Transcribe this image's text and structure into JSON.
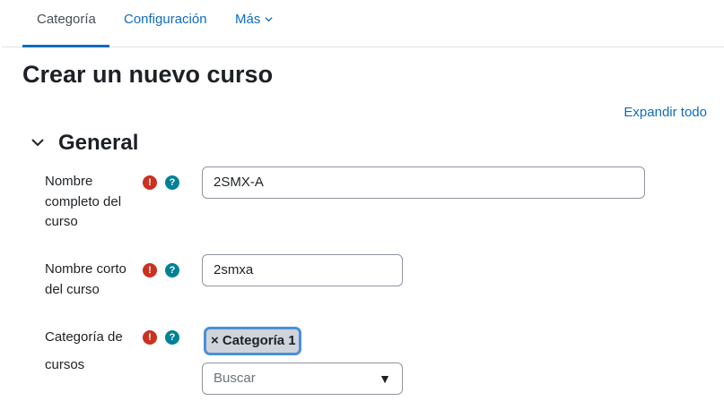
{
  "tabs": [
    {
      "label": "Categoría",
      "active": true
    },
    {
      "label": "Configuración"
    },
    {
      "label": "Más"
    }
  ],
  "page_title": "Crear un nuevo curso",
  "expand_all": "Expandir todo",
  "section": {
    "title": "General"
  },
  "fields": {
    "fullname": {
      "label": "Nombre completo del curso",
      "value": "2SMX-A"
    },
    "shortname": {
      "label": "Nombre corto del curso",
      "value": "2smxa"
    },
    "category": {
      "label": "Categoría de cursos",
      "selected": "× Categoría 1",
      "placeholder": "Buscar",
      "arrow": "▼"
    }
  },
  "icons": {
    "required": "!",
    "help": "?"
  },
  "colors": {
    "accent": "#0f6cbf",
    "required": "#ca3120",
    "help": "#008196"
  }
}
